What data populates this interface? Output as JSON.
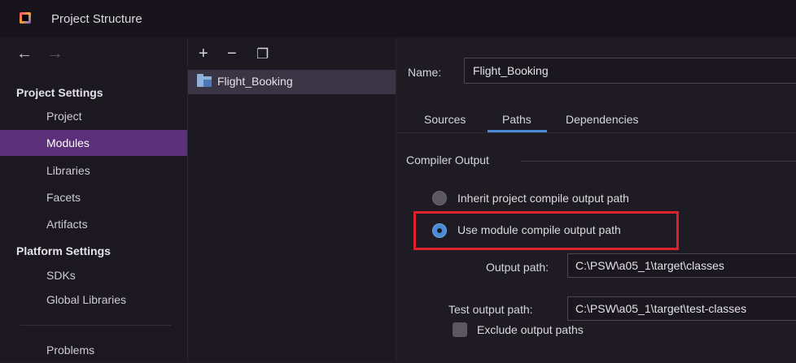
{
  "window": {
    "title": "Project Structure"
  },
  "sidebar": {
    "back_glyph": "←",
    "forward_glyph": "→",
    "project_settings_title": "Project Settings",
    "project_items": [
      {
        "label": "Project"
      },
      {
        "label": "Modules",
        "selected": true
      },
      {
        "label": "Libraries"
      },
      {
        "label": "Facets"
      },
      {
        "label": "Artifacts"
      }
    ],
    "platform_settings_title": "Platform Settings",
    "platform_items": [
      {
        "label": "SDKs"
      },
      {
        "label": "Global Libraries"
      }
    ],
    "problems_label": "Problems"
  },
  "modules_panel": {
    "add_glyph": "+",
    "remove_glyph": "−",
    "copy_glyph": "❐",
    "modules": [
      {
        "name": "Flight_Booking",
        "icon": "module-folder-icon"
      }
    ]
  },
  "module_settings": {
    "name_label": "Name:",
    "name_value": "Flight_Booking",
    "tabs": [
      {
        "label": "Sources"
      },
      {
        "label": "Paths",
        "active": true
      },
      {
        "label": "Dependencies"
      }
    ],
    "compiler_output_label": "Compiler Output",
    "option_inherit": "Inherit project compile output path",
    "option_module": "Use module compile output path",
    "selected_option": "module",
    "output_path_label": "Output path:",
    "output_path_value": "C:\\PSW\\a05_1\\target\\classes",
    "test_output_path_label": "Test output path:",
    "test_output_path_value": "C:\\PSW\\a05_1\\target\\test-classes",
    "exclude_label": "Exclude output paths",
    "exclude_checked": false
  },
  "colors": {
    "selection": "#5b2f7a",
    "accent_blue": "#4a8cd8",
    "highlight_red": "#e0202a"
  }
}
